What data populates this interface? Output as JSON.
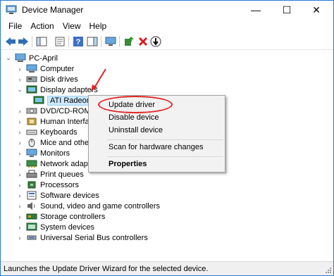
{
  "window": {
    "title": "Device Manager",
    "min_glyph": "—",
    "max_glyph": "☐",
    "close_glyph": "✕"
  },
  "menu": [
    "File",
    "Action",
    "View",
    "Help"
  ],
  "toolbar_icons": [
    "back-arrow-icon",
    "forward-arrow-icon",
    "show-hide-console-tree-icon",
    "properties-icon",
    "help-icon",
    "action-pane-icon",
    "monitor-icon",
    "update-driver-icon",
    "uninstall-device-icon",
    "scan-hardware-icon"
  ],
  "tree": {
    "root": "PC-April",
    "items": [
      {
        "label": "Computer",
        "icon": "computer-icon"
      },
      {
        "label": "Disk drives",
        "icon": "disk-drive-icon"
      },
      {
        "label": "Display adapters",
        "icon": "display-adapter-icon",
        "expanded": true
      },
      {
        "label": "ATI Radeon",
        "icon": "display-adapter-icon",
        "child": true
      },
      {
        "label": "DVD/CD-ROM",
        "icon": "dvd-drive-icon"
      },
      {
        "label": "Human Interfac",
        "icon": "hid-icon"
      },
      {
        "label": "Keyboards",
        "icon": "keyboard-icon"
      },
      {
        "label": "Mice and other",
        "icon": "mouse-icon"
      },
      {
        "label": "Monitors",
        "icon": "monitor-icon"
      },
      {
        "label": "Network adapte",
        "icon": "network-adapter-icon"
      },
      {
        "label": "Print queues",
        "icon": "printer-icon"
      },
      {
        "label": "Processors",
        "icon": "processor-icon"
      },
      {
        "label": "Software devices",
        "icon": "software-device-icon"
      },
      {
        "label": "Sound, video and game controllers",
        "icon": "sound-icon"
      },
      {
        "label": "Storage controllers",
        "icon": "storage-controller-icon"
      },
      {
        "label": "System devices",
        "icon": "system-device-icon"
      },
      {
        "label": "Universal Serial Bus controllers",
        "icon": "usb-icon"
      }
    ]
  },
  "context_menu": {
    "update_driver": "Update driver",
    "disable_device": "Disable device",
    "uninstall_device": "Uninstall device",
    "scan": "Scan for hardware changes",
    "properties": "Properties"
  },
  "status": "Launches the Update Driver Wizard for the selected device.",
  "colors": {
    "annotation": "#e02626",
    "selection": "#cce8ff",
    "window_border": "#2b79d8"
  }
}
